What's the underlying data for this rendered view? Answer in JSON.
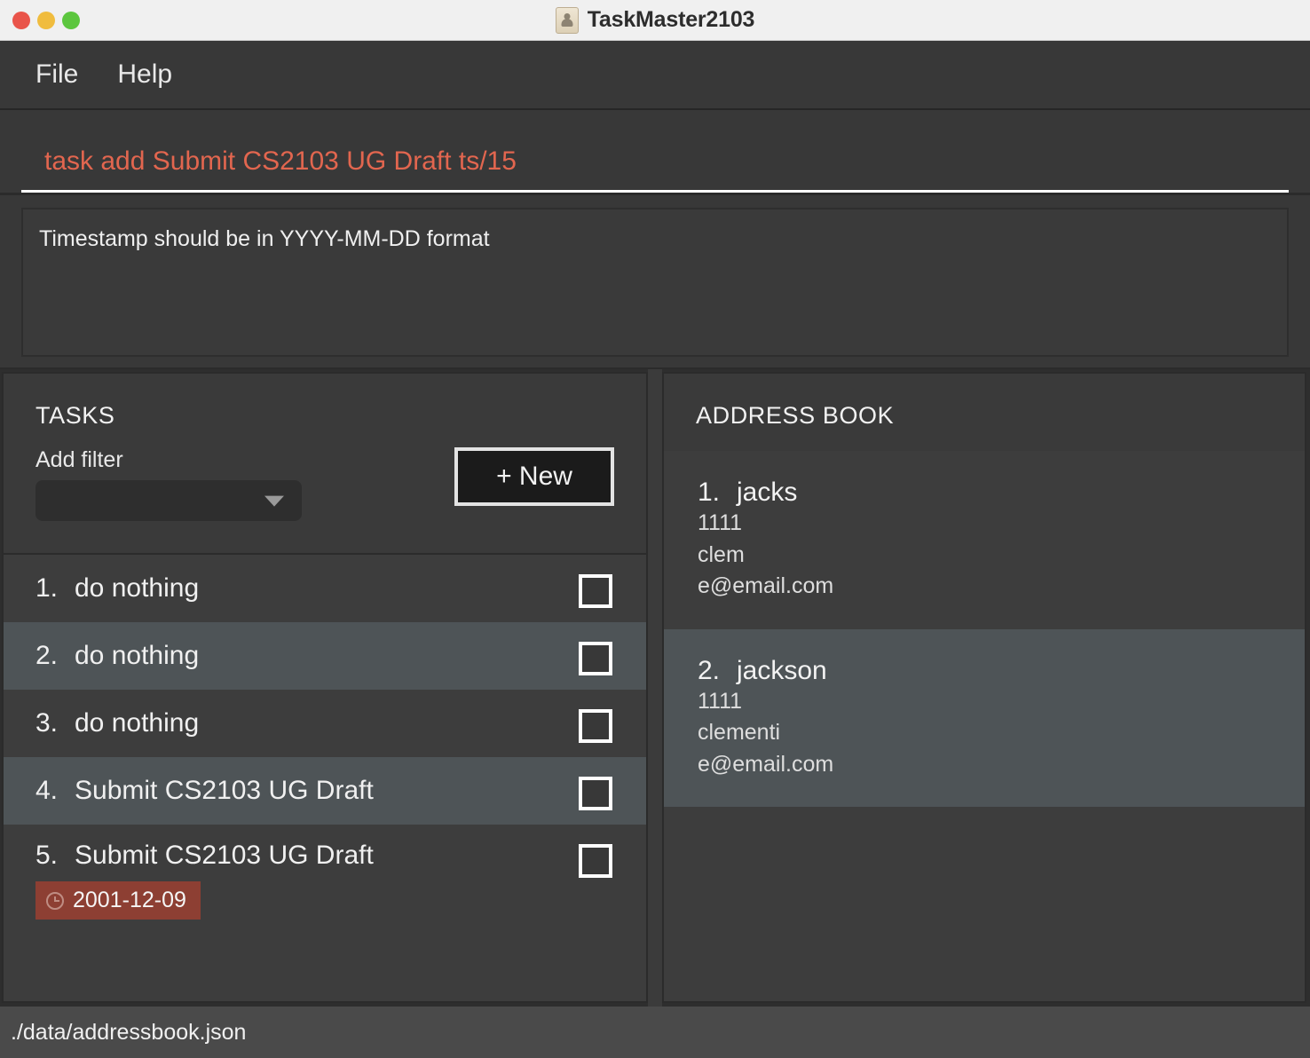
{
  "window": {
    "title": "TaskMaster2103",
    "icon": "address-book-person-icon",
    "traffic_lights": [
      "close",
      "minimize",
      "zoom"
    ]
  },
  "menubar": {
    "items": [
      {
        "label": "File"
      },
      {
        "label": "Help"
      }
    ]
  },
  "command": {
    "value": "task add Submit CS2103 UG Draft ts/15",
    "placeholder": "Enter command here...",
    "text_color": "#e2664f"
  },
  "result": {
    "message": "Timestamp should be in YYYY-MM-DD format"
  },
  "tasks_panel": {
    "title": "TASKS",
    "filter_label": "Add filter",
    "filter_value": "",
    "new_button": "+ New",
    "items": [
      {
        "index": "1.",
        "name": "do nothing",
        "checked": false,
        "date": null
      },
      {
        "index": "2.",
        "name": "do nothing",
        "checked": false,
        "date": null
      },
      {
        "index": "3.",
        "name": "do nothing",
        "checked": false,
        "date": null
      },
      {
        "index": "4.",
        "name": "Submit CS2103 UG Draft",
        "checked": false,
        "date": null
      },
      {
        "index": "5.",
        "name": "Submit CS2103 UG Draft",
        "checked": false,
        "date": "2001-12-09"
      }
    ]
  },
  "address_panel": {
    "title": "ADDRESS BOOK",
    "items": [
      {
        "index": "1.",
        "name": "jacks",
        "phone": "1111",
        "address": "clem",
        "email": "e@email.com"
      },
      {
        "index": "2.",
        "name": "jackson",
        "phone": "1111",
        "address": "clementi",
        "email": "e@email.com"
      }
    ]
  },
  "statusbar": {
    "path": "./data/addressbook.json"
  },
  "colors": {
    "accent_error": "#e2664f",
    "badge": "#8d3f33",
    "row_alt": "#4e5457",
    "panel_bg": "#3a3a3a",
    "window_bg": "#383838"
  }
}
